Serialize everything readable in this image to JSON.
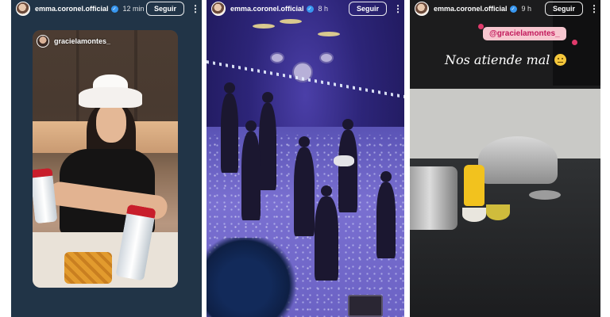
{
  "stories": [
    {
      "username": "emma.coronel.official",
      "time_ago": "12 min",
      "follow_label": "Seguir",
      "more_icon": "⋮",
      "mention": "gracielamontes_"
    },
    {
      "username": "emma.coronel.official",
      "time_ago": "8 h",
      "follow_label": "Seguir",
      "more_icon": "⋮"
    },
    {
      "username": "emma.coronel.official",
      "time_ago": "9 h",
      "follow_label": "Seguir",
      "more_icon": "⋮",
      "mention": "@gracielamontes_",
      "caption": "Nos atiende mal"
    }
  ],
  "icons": {
    "verified": "verified-badge-icon",
    "more": "more-options-icon",
    "emoji": "neutral-face-emoji-icon"
  },
  "colors": {
    "verified_blue": "#3897f0",
    "mention_pink_bg": "#f7c6cf",
    "mention_pink_text": "#c2185b"
  }
}
